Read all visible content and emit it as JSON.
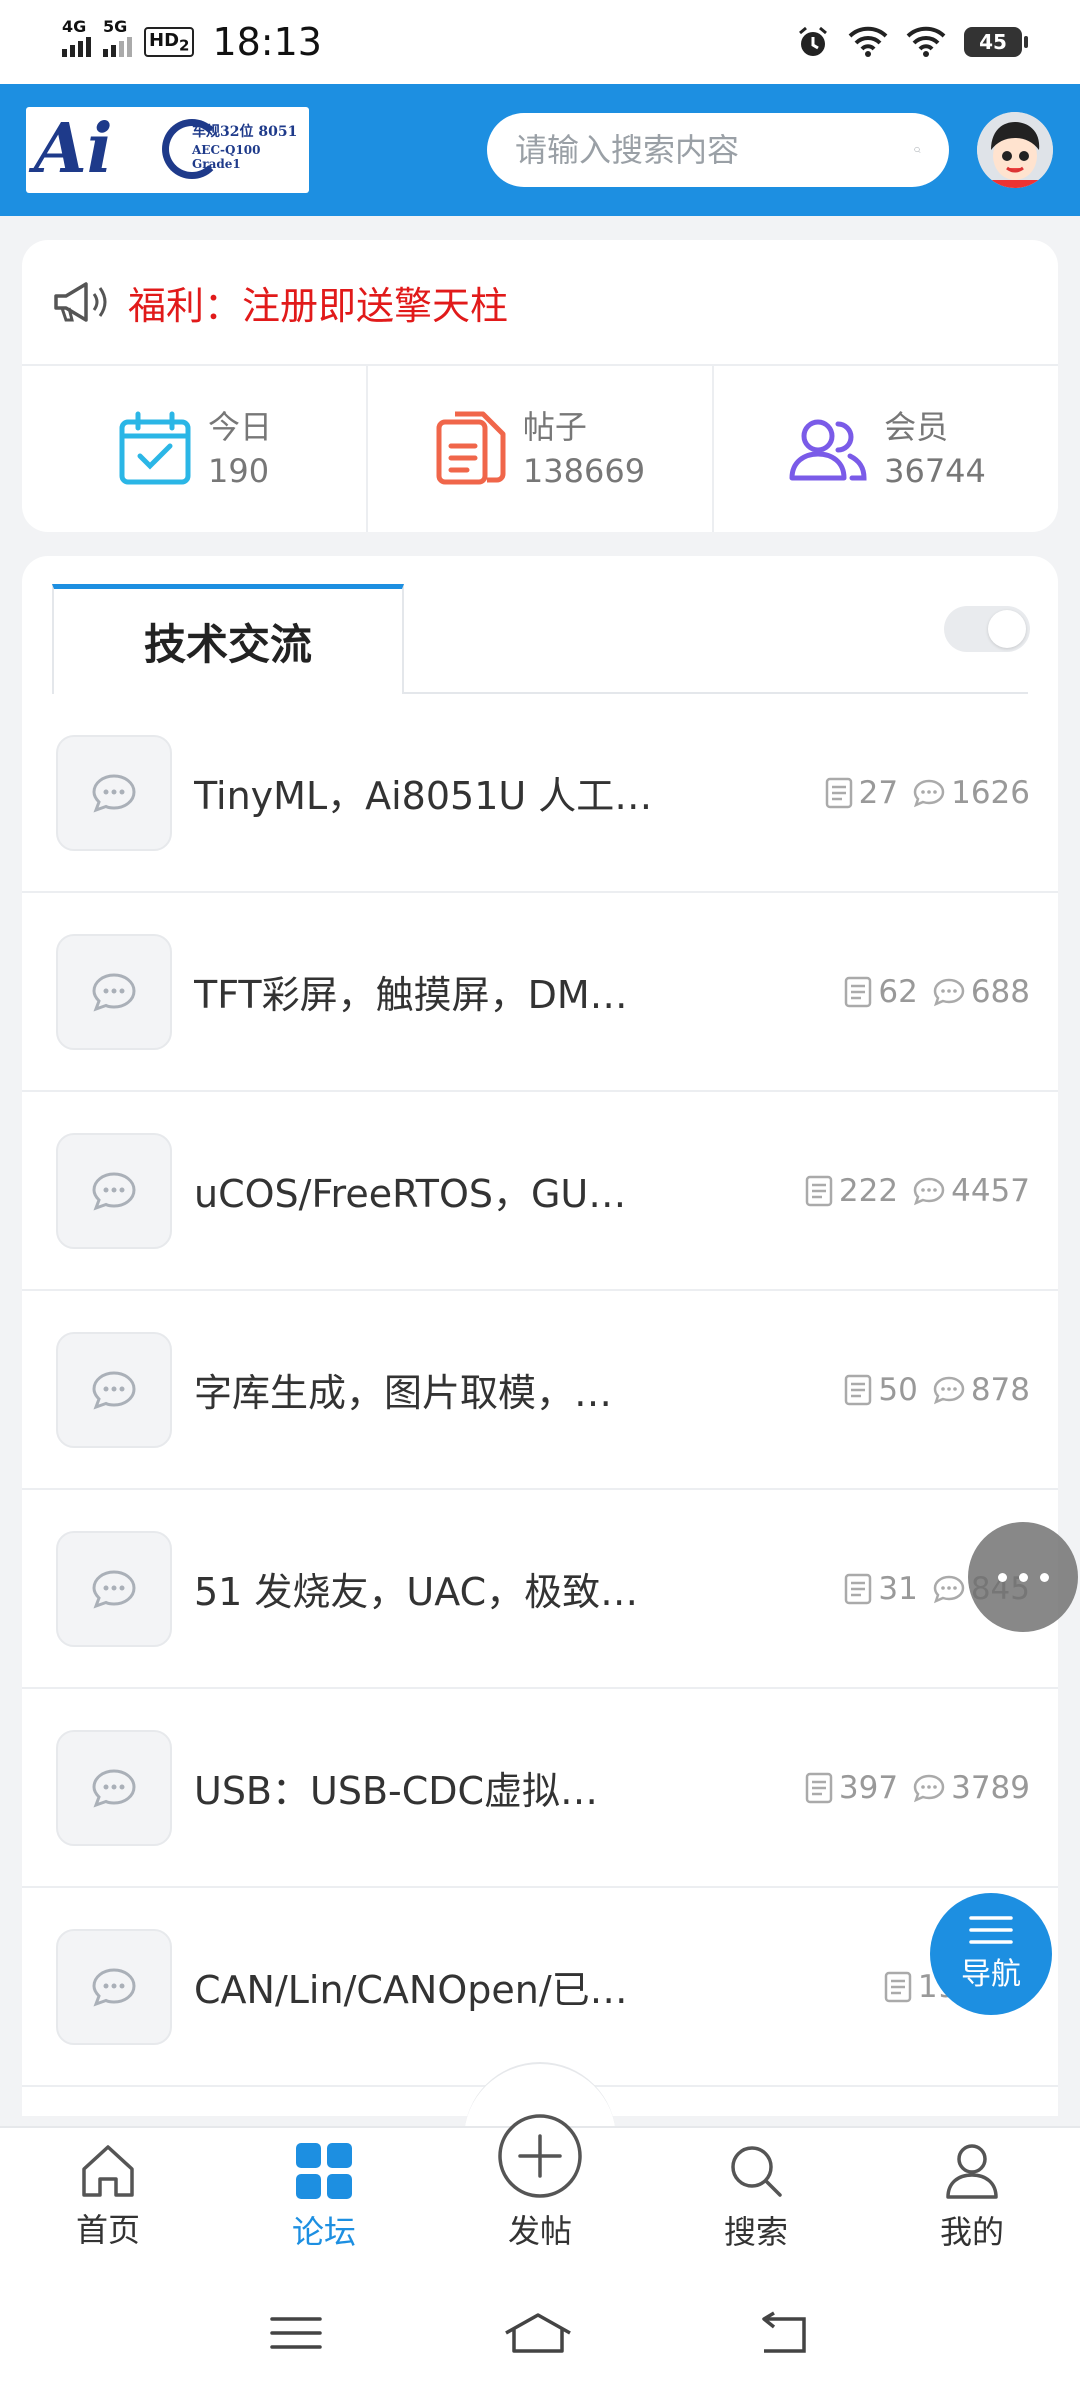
{
  "status_bar": {
    "net1": "4G",
    "net2": "5G",
    "hd": "HD",
    "hd_sub": "2",
    "time": "18:13",
    "battery": "45"
  },
  "header": {
    "logo_text": "Ai",
    "logo_line1": "车规32位 8051",
    "logo_line2": "AEC-Q100 Grade1",
    "search_placeholder": "请输入搜索内容"
  },
  "notice": {
    "text": "福利：注册即送擎天柱"
  },
  "stats": [
    {
      "label": "今日",
      "value": "190",
      "icon": "calendar-check-icon",
      "color": "#2bb6e6"
    },
    {
      "label": "帖子",
      "value": "138669",
      "icon": "document-icon",
      "color": "#f0664a"
    },
    {
      "label": "会员",
      "value": "36744",
      "icon": "users-icon",
      "color": "#7a5be8"
    }
  ],
  "forum": {
    "tab_label": "技术交流",
    "items": [
      {
        "title": "TinyML，Ai8051U 人工…",
        "threads": "27",
        "posts": "1626"
      },
      {
        "title": "TFT彩屏，触摸屏，DM…",
        "threads": "62",
        "posts": "688"
      },
      {
        "title": "uCOS/FreeRTOS，GU…",
        "threads": "222",
        "posts": "4457"
      },
      {
        "title": "字库生成，图片取模，…",
        "threads": "50",
        "posts": "878"
      },
      {
        "title": "51 发烧友，UAC，极致…",
        "threads": "31",
        "posts": "845"
      },
      {
        "title": "USB：USB-CDC虚拟…",
        "threads": "397",
        "posts": "3789"
      },
      {
        "title": "CAN/Lin/CANOpen/已…",
        "threads": "191",
        "posts": ""
      }
    ]
  },
  "float_nav": {
    "label": "导航"
  },
  "tabbar": [
    {
      "label": "首页",
      "icon": "home-icon"
    },
    {
      "label": "论坛",
      "icon": "grid-icon",
      "active": true
    },
    {
      "label": "发帖",
      "icon": "plus-circle-icon"
    },
    {
      "label": "搜索",
      "icon": "search-icon"
    },
    {
      "label": "我的",
      "icon": "user-icon"
    }
  ],
  "colors": {
    "primary": "#1d8fe1",
    "notice_red": "#e11a1a"
  }
}
